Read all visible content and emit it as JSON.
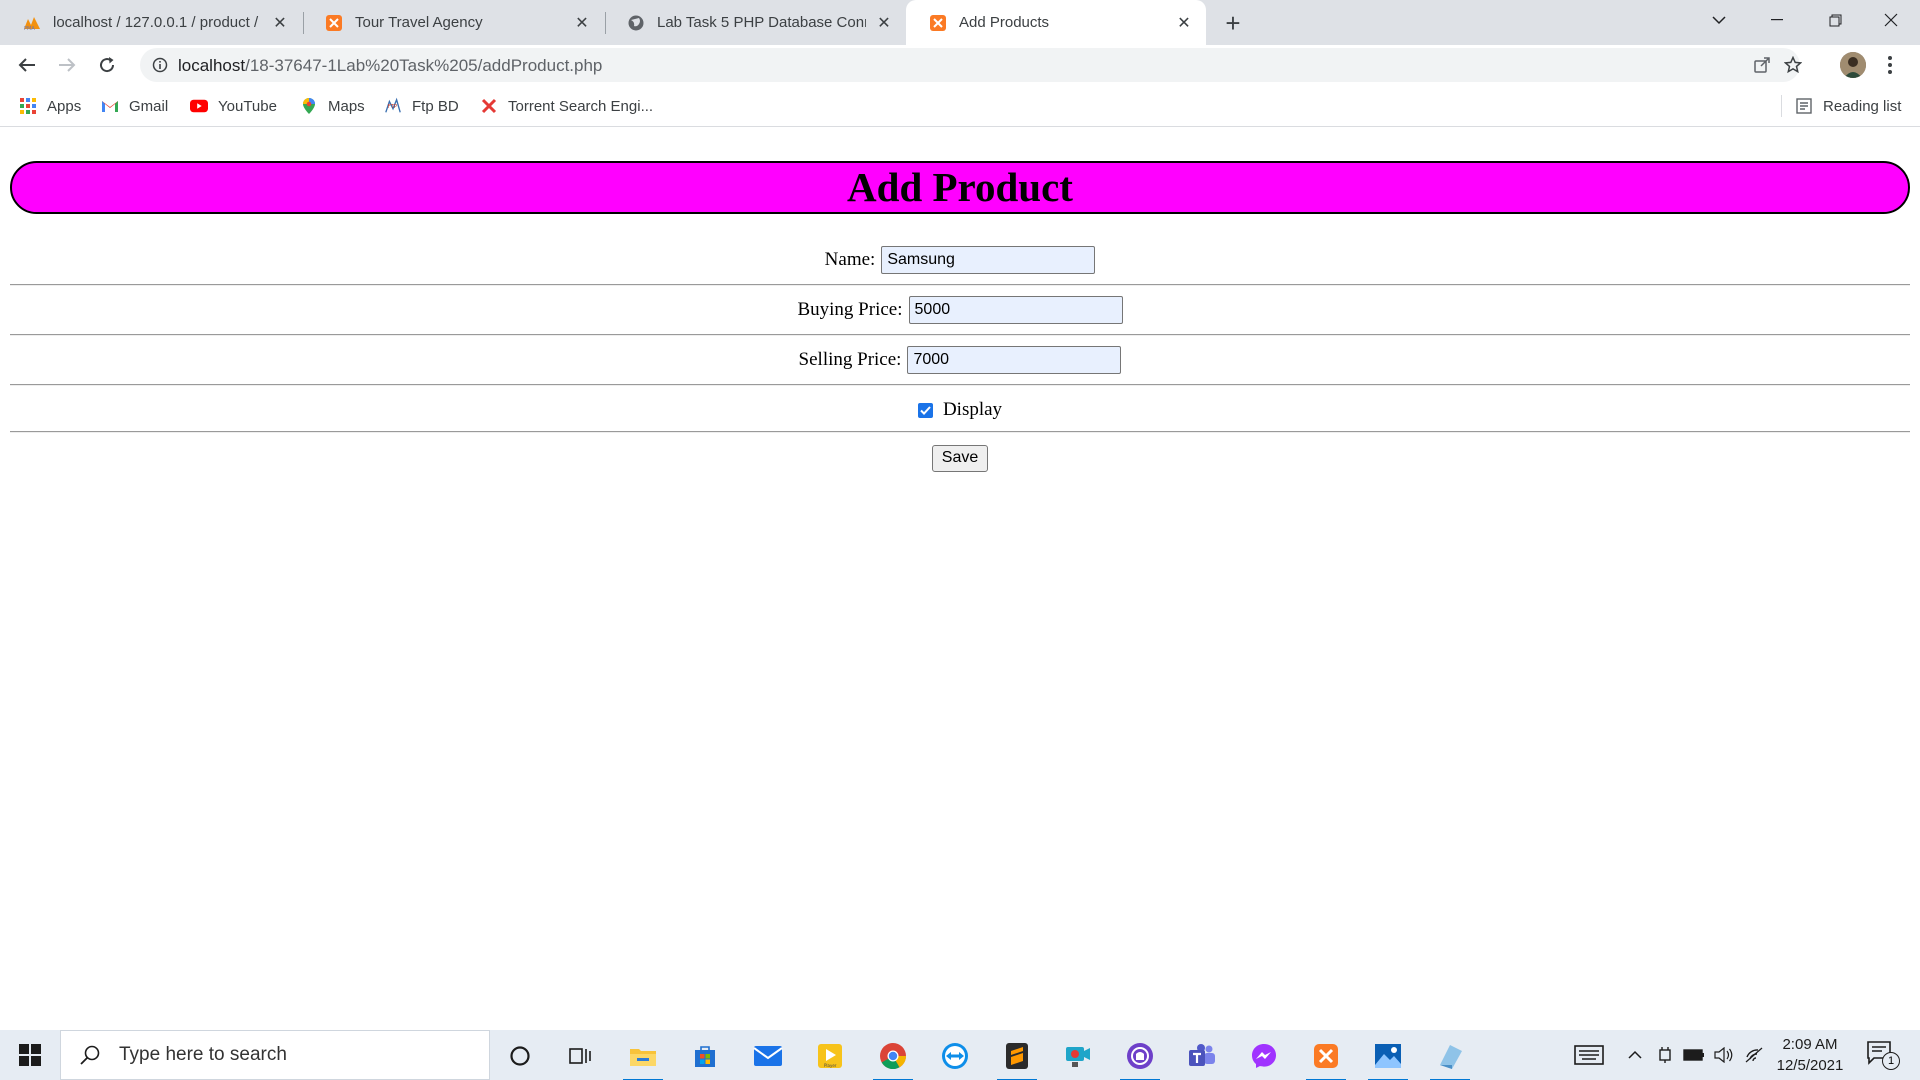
{
  "browser": {
    "tabs": [
      {
        "title": "localhost / 127.0.0.1 / product / p",
        "icon": "phpmyadmin-icon"
      },
      {
        "title": "Tour Travel Agency",
        "icon": "xampp-icon"
      },
      {
        "title": "Lab Task 5 PHP Database Connec",
        "icon": "globe-icon"
      },
      {
        "title": "Add Products",
        "icon": "xampp-icon",
        "active": true
      }
    ],
    "new_tab_label": "+",
    "url_host": "localhost",
    "url_path": "/18-37647-1Lab%20Task%205/addProduct.php"
  },
  "bookmarks": [
    {
      "label": "Apps",
      "icon": "apps-grid-icon"
    },
    {
      "label": "Gmail",
      "icon": "gmail-icon"
    },
    {
      "label": "YouTube",
      "icon": "youtube-icon"
    },
    {
      "label": "Maps",
      "icon": "maps-pin-icon"
    },
    {
      "label": "Ftp BD",
      "icon": "ftp-icon"
    },
    {
      "label": "Torrent Search Engi...",
      "icon": "torrent-x-icon"
    }
  ],
  "reading_list_label": "Reading list",
  "page": {
    "title": "Add Product",
    "name_label": "Name:",
    "name_value": "Samsung",
    "buying_label": "Buying Price:",
    "buying_value": "5000",
    "selling_label": "Selling Price:",
    "selling_value": "7000",
    "display_label": "Display",
    "display_checked": true,
    "save_label": "Save"
  },
  "taskbar": {
    "search_placeholder": "Type here to search",
    "time": "2:09 AM",
    "date": "12/5/2021",
    "notification_count": "1"
  },
  "colors": {
    "title_bg": "#ff00ff",
    "input_autofill": "#e8f0fe",
    "checkbox": "#1a73e8",
    "tab_strip": "#dee1e6"
  }
}
